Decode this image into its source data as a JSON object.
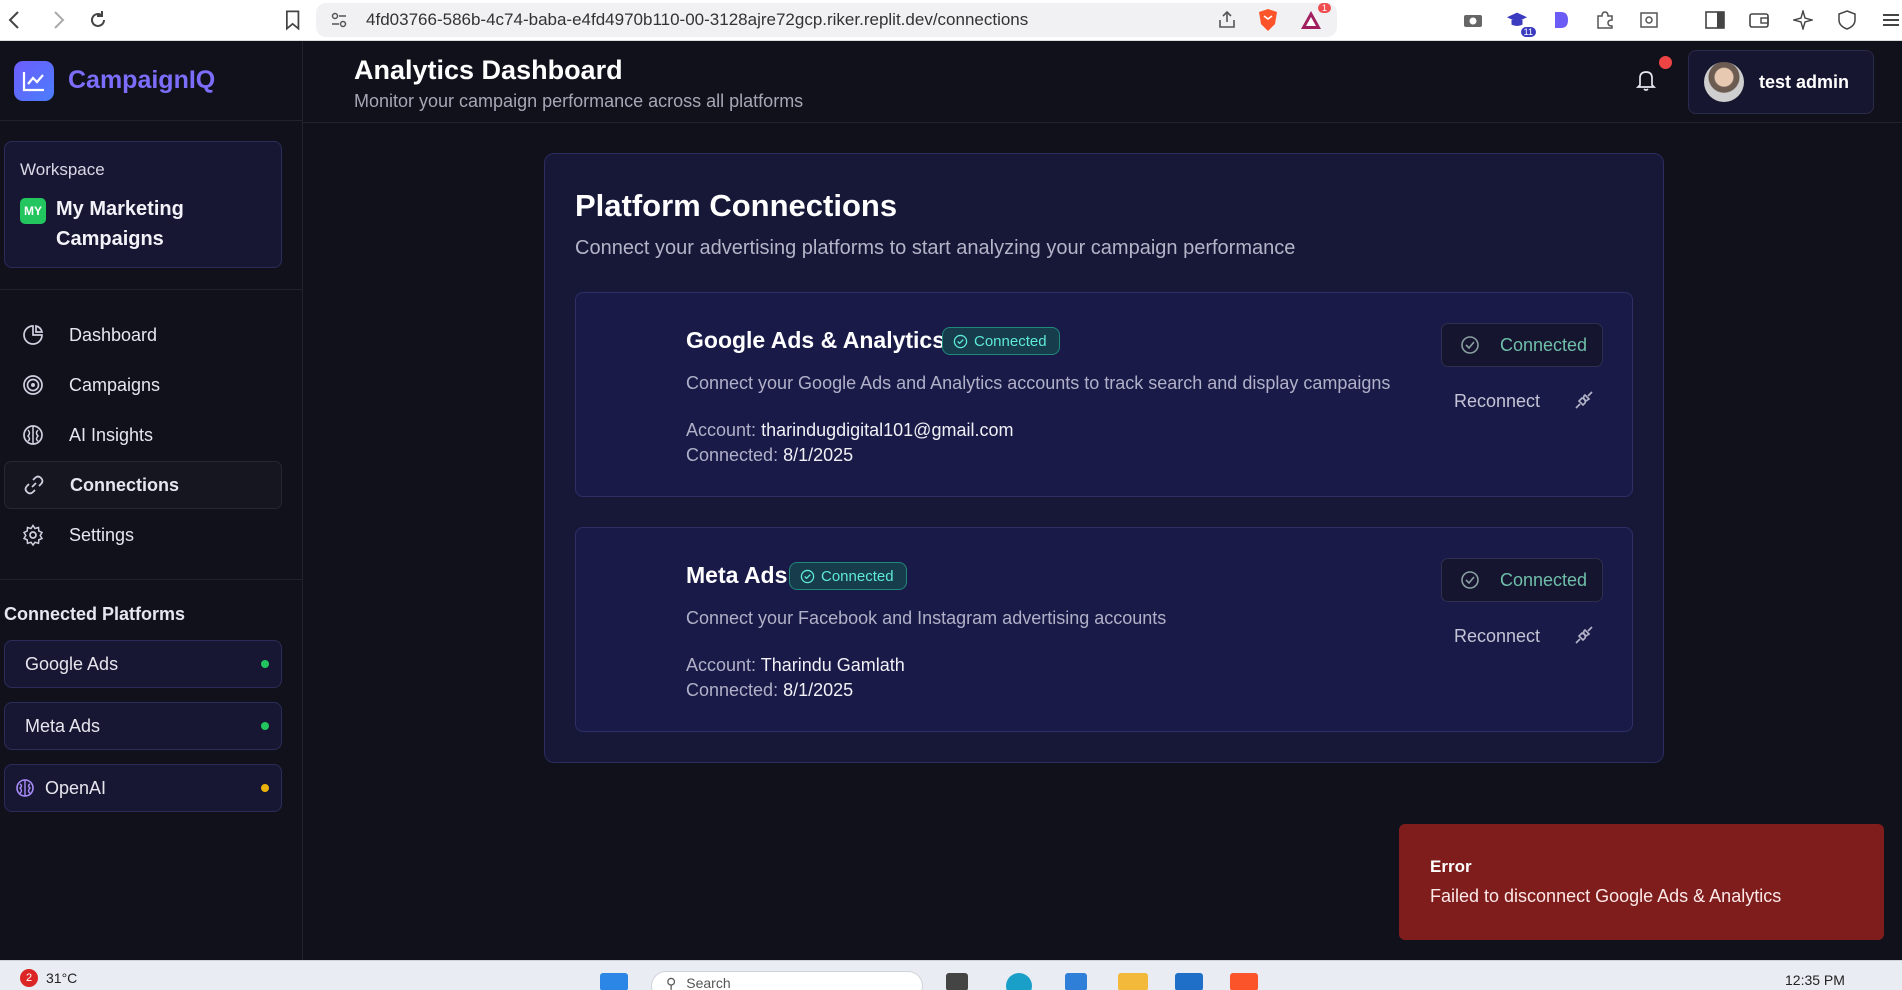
{
  "browser": {
    "url": "4fd03766-586b-4c74-baba-e4fd4970b110-00-3128ajre72gcp.riker.replit.dev/connections",
    "extension_badge": "11",
    "alert_badge": "1"
  },
  "sidebar": {
    "brand": "CampaignIQ",
    "workspace_label": "Workspace",
    "workspace_badge": "MY",
    "workspace_name": "My Marketing Campaigns",
    "nav": [
      {
        "label": "Dashboard",
        "icon": "pie-chart-icon"
      },
      {
        "label": "Campaigns",
        "icon": "target-icon"
      },
      {
        "label": "AI Insights",
        "icon": "brain-icon"
      },
      {
        "label": "Connections",
        "icon": "link-icon",
        "active": true
      },
      {
        "label": "Settings",
        "icon": "gear-icon"
      }
    ],
    "connected_title": "Connected Platforms",
    "platforms": [
      {
        "label": "Google Ads",
        "status_color": "#22c55e"
      },
      {
        "label": "Meta Ads",
        "status_color": "#22c55e"
      },
      {
        "label": "OpenAI",
        "status_color": "#eab308"
      }
    ]
  },
  "header": {
    "title": "Analytics Dashboard",
    "subtitle": "Monitor your campaign performance across all platforms",
    "user_name": "test admin"
  },
  "main": {
    "title": "Platform Connections",
    "subtitle": "Connect your advertising platforms to start analyzing your campaign performance",
    "connections": [
      {
        "name": "Google Ads & Analytics",
        "badge": "Connected",
        "description": "Connect your Google Ads and Analytics accounts to track search and display campaigns",
        "account_label": "Account:",
        "account": "tharindugdigital101@gmail.com",
        "connected_label": "Connected:",
        "connected_date": "8/1/2025",
        "status_button": "Connected",
        "reconnect": "Reconnect"
      },
      {
        "name": "Meta Ads",
        "badge": "Connected",
        "description": "Connect your Facebook and Instagram advertising accounts",
        "account_label": "Account:",
        "account": "Tharindu Gamlath",
        "connected_label": "Connected:",
        "connected_date": "8/1/2025",
        "status_button": "Connected",
        "reconnect": "Reconnect"
      }
    ]
  },
  "toast": {
    "title": "Error",
    "message": "Failed to disconnect Google Ads & Analytics"
  },
  "taskbar": {
    "weather_badge": "2",
    "temperature": "31°C",
    "search_placeholder": "Search",
    "time": "12:35 PM"
  },
  "colors": {
    "accent": "#7c6dfa",
    "connected_teal": "#5eead4",
    "toast_red": "#7f1d1d",
    "panel": "#171738"
  }
}
